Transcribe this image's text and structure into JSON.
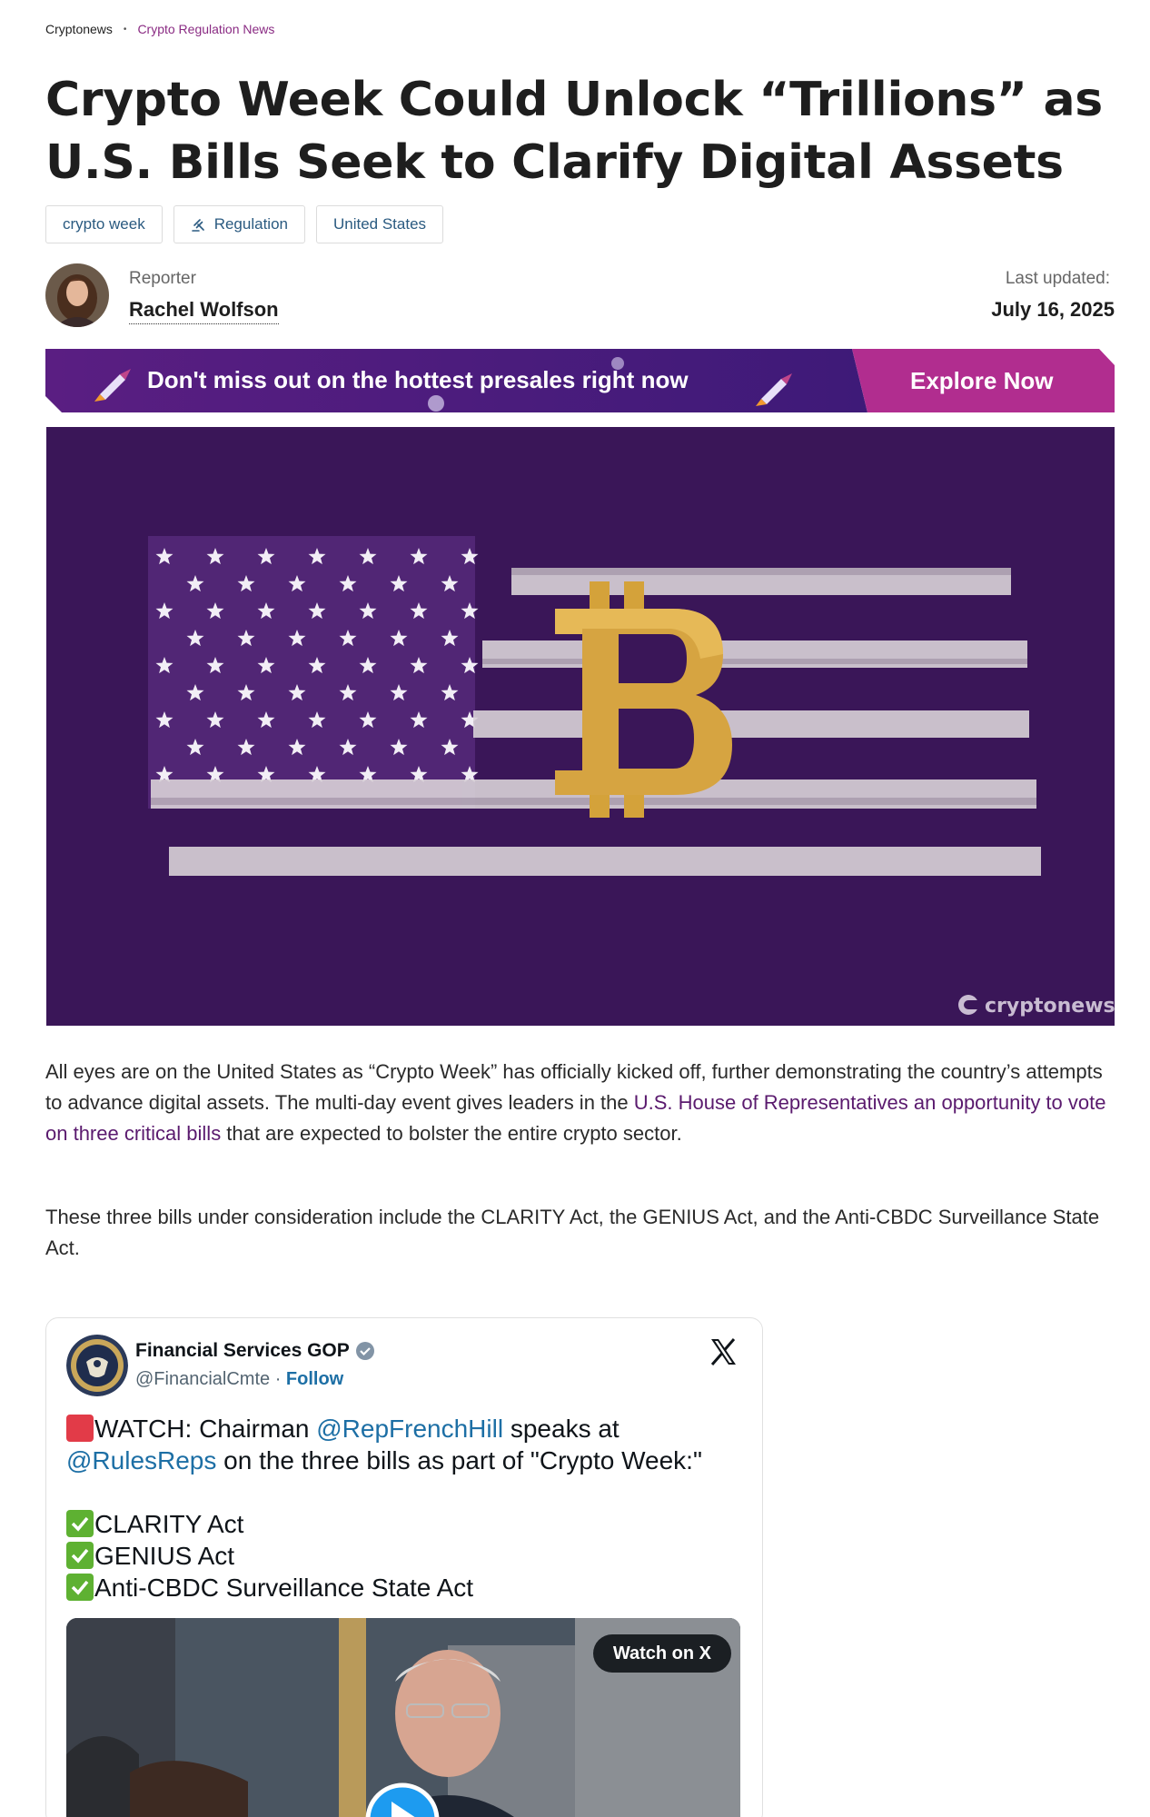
{
  "breadcrumb": {
    "home": "Cryptonews",
    "separator": "•",
    "section": "Crypto Regulation News"
  },
  "article": {
    "title": "Crypto Week Could Unlock “Trillions” as U.S. Bills Seek to Clarify Digital Assets",
    "tags": [
      "crypto week",
      "Regulation",
      "United States"
    ],
    "author_label": "Reporter",
    "author_name": "Rachel Wolfson",
    "updated_label": "Last updated:",
    "updated_date": "July 16, 2025"
  },
  "promo": {
    "text": "Don't miss out on the hottest presales right now",
    "button": "Explore Now"
  },
  "hero": {
    "watermark": "cryptonews",
    "icon": "bitcoin-flag-image"
  },
  "body": {
    "p1_a": "All eyes are on the United States as “Crypto Week” has officially kicked off, further demonstrating the country’s attempts to advance digital assets. The multi-day event gives leaders in the ",
    "p1_link": "U.S. House of Representatives an opportunity to vote on three critical bills",
    "p1_b": " that are expected to bolster the entire crypto sector.",
    "p2": "These three bills under consideration include the CLARITY Act, the GENIUS Act, and the Anti-CBDC Surveillance State Act."
  },
  "tweet": {
    "name": "Financial Services GOP",
    "handle": "@FinancialCmte",
    "dot": "·",
    "follow": "Follow",
    "line1_a": "WATCH: Chairman ",
    "line1_mention": "@RepFrenchHill",
    "line1_b": " speaks at",
    "line2_mention": "@RulesReps",
    "line2_b": " on the three bills as part of \"Crypto Week:\"",
    "items": [
      "CLARITY Act",
      "GENIUS Act",
      "Anti-CBDC Surveillance State Act"
    ],
    "watch": "Watch on X"
  },
  "colors": {
    "accent": "#8a2b83",
    "promo_bg": "#4a1a7a",
    "promo_button": "#b12d8f",
    "hero_bg": "#3a1658",
    "bitcoin_gold": "#d4a23a",
    "link": "#1d6fa5"
  }
}
